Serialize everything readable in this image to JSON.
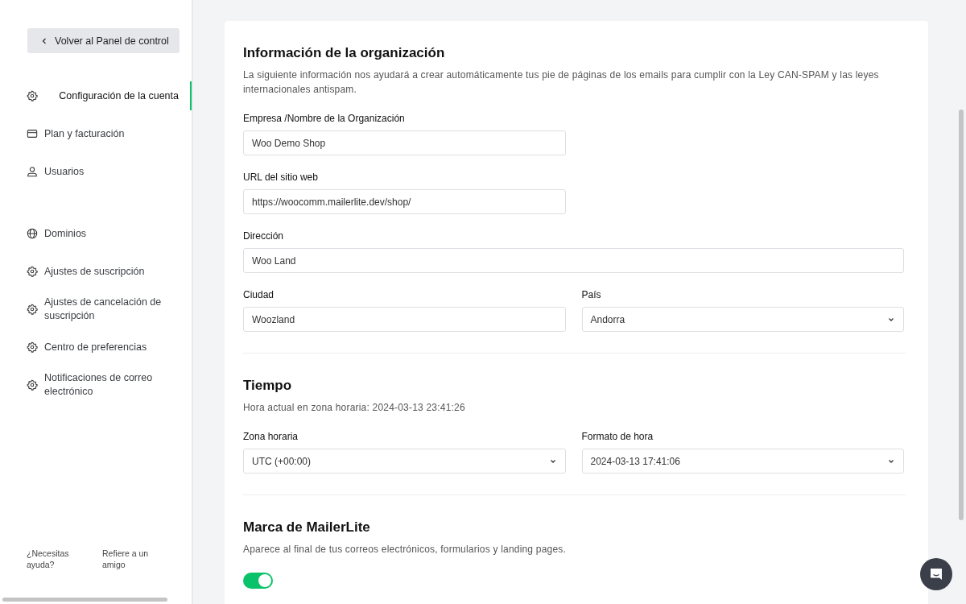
{
  "sidebar": {
    "back_button": {
      "label": "Volver al Panel de control"
    },
    "groups": [
      {
        "items": [
          {
            "label": "Configuración de la cuenta",
            "kind": "gear",
            "selected": true
          },
          {
            "label": "Plan y facturación",
            "kind": "card",
            "selected": false
          },
          {
            "label": "Usuarios",
            "kind": "user",
            "selected": false
          }
        ]
      },
      {
        "items": [
          {
            "label": "Dominios",
            "kind": "globe",
            "selected": false
          },
          {
            "label": "Ajustes de suscripción",
            "kind": "gear",
            "selected": false
          },
          {
            "label": "Ajustes de cancelación de suscripción",
            "kind": "gear",
            "selected": false
          },
          {
            "label": "Centro de preferencias",
            "kind": "gear",
            "selected": false
          },
          {
            "label": "Notificaciones de correo electrónico",
            "kind": "gear",
            "selected": false
          }
        ]
      }
    ],
    "footer_links": [
      "¿Necesitas ayuda?",
      "Refiere a un amigo"
    ]
  },
  "sections": [
    {
      "title": "Información de la organización",
      "description": "La siguiente información nos ayudará a crear automáticamente tus pie de páginas de los emails para cumplir con la Ley CAN-SPAM y las leyes internacionales antispam.",
      "rows": [
        [
          {
            "label": "Empresa /Nombre de la Organización",
            "kind": "text",
            "value": "Woo Demo Shop"
          },
          {
            "kind": "empty"
          }
        ],
        [
          {
            "label": "URL del sitio web",
            "kind": "text",
            "value": "https://woocomm.mailerlite.dev/shop/"
          },
          {
            "kind": "empty"
          }
        ],
        [
          {
            "label": "Dirección",
            "kind": "text",
            "value": "Woo Land"
          }
        ],
        [
          {
            "label": "Ciudad",
            "kind": "text",
            "value": "Woozland"
          },
          {
            "label": "País",
            "kind": "select",
            "value": "Andorra"
          }
        ]
      ]
    },
    {
      "title": "Tiempo",
      "description": "Hora actual en zona horaria: 2024-03-13 23:41:26",
      "rows": [
        [
          {
            "label": "Zona horaria",
            "kind": "select",
            "value": "UTC (+00:00)"
          },
          {
            "label": "Formato de hora",
            "kind": "select",
            "value": "2024-03-13 17:41:06"
          }
        ]
      ]
    },
    {
      "title": "Marca de MailerLite",
      "description": "Aparece al final de tus correos electrónicos, formularios y landing pages.",
      "toggle": {
        "on": true
      }
    }
  ]
}
